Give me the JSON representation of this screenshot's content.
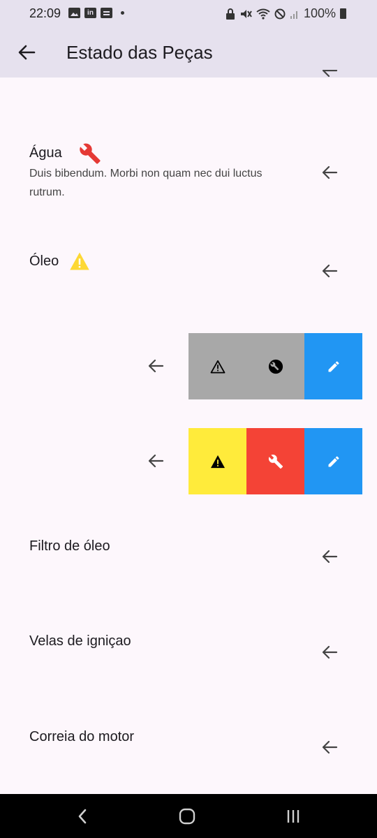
{
  "status_bar": {
    "time": "22:09",
    "battery": "100%",
    "left_icons": [
      "image-icon",
      "linkedin-icon",
      "photo-icon"
    ],
    "right_icons": [
      "lock-icon",
      "mute-icon",
      "wifi-icon",
      "dnd-icon",
      "signal-icon",
      "battery-icon"
    ]
  },
  "app_bar": {
    "title": "Estado das Peças",
    "back_icon": "back-arrow-icon"
  },
  "items": [
    {
      "title": "Água",
      "subtitle": "Duis bibendum. Morbi non quam nec dui luctus rutrum.",
      "status_icon": "wrench-icon",
      "status_color": "#e53935"
    },
    {
      "title": "Óleo",
      "subtitle": "",
      "status_icon": "warning-icon",
      "status_color": "#fdd835"
    },
    {
      "title": "Filtro de óleo",
      "subtitle": ""
    },
    {
      "title": "Velas de igniçao",
      "subtitle": ""
    },
    {
      "title": "Correia do motor",
      "subtitle": ""
    }
  ],
  "action_panels": [
    {
      "warning_color": "#a8a8a8",
      "repair_color": "#a8a8a8",
      "edit_color": "#2196f3",
      "style": "outlined-warning"
    },
    {
      "warning_color": "#ffeb3b",
      "repair_color": "#f44336",
      "edit_color": "#2196f3",
      "style": "filled"
    }
  ],
  "nav_bar": {
    "icons": [
      "nav-back-icon",
      "nav-home-icon",
      "nav-recents-icon"
    ]
  }
}
